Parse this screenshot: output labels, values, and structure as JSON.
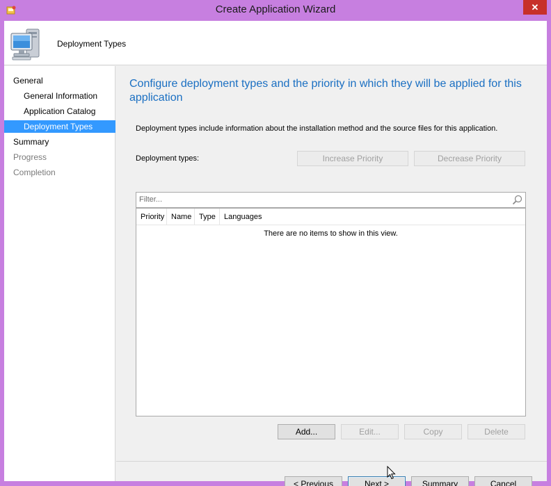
{
  "window": {
    "title": "Create Application Wizard",
    "close_glyph": "✕"
  },
  "header": {
    "title": "Deployment Types",
    "icon": "computer-icon"
  },
  "nav": {
    "items": [
      {
        "label": "General",
        "level": "top",
        "state": "normal"
      },
      {
        "label": "General Information",
        "level": "sub",
        "state": "normal"
      },
      {
        "label": "Application Catalog",
        "level": "sub",
        "state": "normal"
      },
      {
        "label": "Deployment Types",
        "level": "sub",
        "state": "selected"
      },
      {
        "label": "Summary",
        "level": "top",
        "state": "normal"
      },
      {
        "label": "Progress",
        "level": "top",
        "state": "disabled"
      },
      {
        "label": "Completion",
        "level": "top",
        "state": "disabled"
      }
    ]
  },
  "main": {
    "heading": "Configure deployment types and the priority in which they will be applied for this application",
    "description": "Deployment types include information about the installation method and the source files for this application.",
    "deployment_types_label": "Deployment types:",
    "increase_priority": "Increase Priority",
    "decrease_priority": "Decrease Priority",
    "filter_placeholder": "Filter...",
    "columns": [
      "Priority",
      "Name",
      "Type",
      "Languages"
    ],
    "empty_message": "There are no items to show in this view.",
    "add": "Add...",
    "edit": "Edit...",
    "copy": "Copy",
    "delete": "Delete"
  },
  "footer": {
    "previous": "< Previous",
    "next": "Next >",
    "summary": "Summary",
    "cancel": "Cancel"
  },
  "colors": {
    "accent": "#1a6fc2",
    "selection": "#3399ff",
    "titlebar": "#c77fe0",
    "close": "#c7302a"
  }
}
